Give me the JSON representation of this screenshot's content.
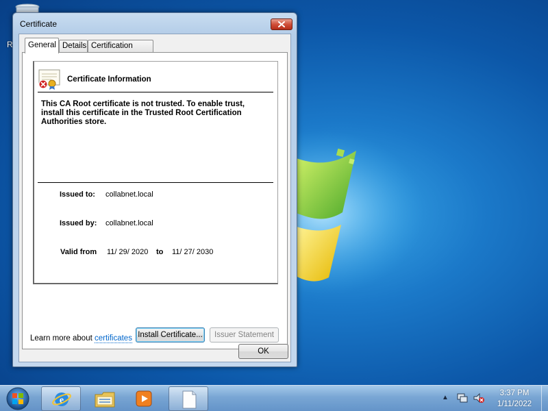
{
  "desktop": {
    "icon_label_fragment": "R"
  },
  "dialog": {
    "title": "Certificate",
    "tabs": [
      {
        "label": "General",
        "active": true
      },
      {
        "label": "Details",
        "active": false
      },
      {
        "label": "Certification Path",
        "active": false
      }
    ],
    "info": {
      "heading": "Certificate Information",
      "warning": "This CA Root certificate is not trusted. To enable trust, install this certificate in the Trusted Root Certification Authorities store.",
      "issued_to_label": "Issued to:",
      "issued_to": "collabnet.local",
      "issued_by_label": "Issued by:",
      "issued_by": "collabnet.local",
      "valid_label": "Valid from",
      "valid_from": "11/ 29/ 2020",
      "to_label": "to",
      "valid_to": "11/ 27/ 2030"
    },
    "buttons": {
      "install": "Install Certificate...",
      "issuer_statement": "Issuer Statement",
      "ok": "OK"
    },
    "learn_more_prefix": "Learn more about ",
    "learn_more_link": "certificates"
  },
  "taskbar": {
    "items": [
      {
        "icon": "start-orb-icon"
      },
      {
        "icon": "internet-explorer-icon",
        "active": true
      },
      {
        "icon": "windows-explorer-icon"
      },
      {
        "icon": "media-player-icon"
      },
      {
        "icon": "notepad-icon",
        "active": true
      }
    ],
    "tray_arrow": "▲",
    "time": "3:37 PM",
    "date": "1/11/2022"
  },
  "colors": {
    "close_button": "#c8422e",
    "link": "#0066cc",
    "desktop": "#1b79c9"
  }
}
